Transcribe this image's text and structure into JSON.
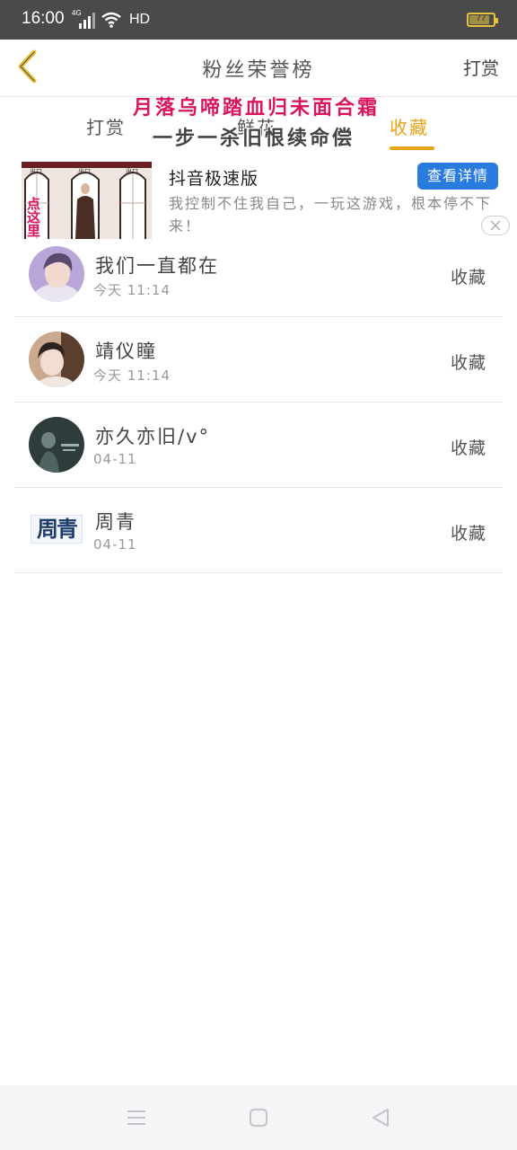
{
  "status_bar": {
    "time": "16:00",
    "network": "4G",
    "hd": "HD",
    "battery": "77",
    "battery_level": 0.77,
    "battery_color": "#e8c23c"
  },
  "header": {
    "title": "粉丝荣誉榜",
    "action": "打赏",
    "back_icon": "chevron-left-icon",
    "back_color": "#e8c23c"
  },
  "tabs": [
    {
      "label": "打赏",
      "active": false
    },
    {
      "label": "鲜花",
      "active": false
    },
    {
      "label": "收藏",
      "active": true
    }
  ],
  "accent_color": "#e8a318",
  "overlay": {
    "line1": "月落乌啼踏血归未面合霜",
    "line2": "一步一杀旧恨续命偿"
  },
  "ad": {
    "title": "抖音极速版",
    "button": "查看详情",
    "description": "我控制不住我自己，一玩这游戏，根本停不下来！",
    "image_label": "点这里",
    "door_labels": [
      "出口",
      "出口",
      "出口"
    ],
    "close_icon": "close-icon",
    "button_color": "#2a7be0"
  },
  "list": [
    {
      "name": "我们一直都在",
      "time": "今天 11:14",
      "action": "收藏",
      "avatar": "avatar-photo-boy"
    },
    {
      "name": "靖仪瞳",
      "time": "今天 11:14",
      "action": "收藏",
      "avatar": "avatar-photo-girl"
    },
    {
      "name": "亦久亦旧/v°",
      "time": "04-11",
      "action": "收藏",
      "avatar": "avatar-photo-dark"
    },
    {
      "name": "周青",
      "time": "04-11",
      "action": "收藏",
      "avatar": "avatar-text-zhouqing",
      "avatar_text": "周青"
    }
  ],
  "nav": [
    "menu-icon",
    "home-icon",
    "back-triangle-icon"
  ]
}
